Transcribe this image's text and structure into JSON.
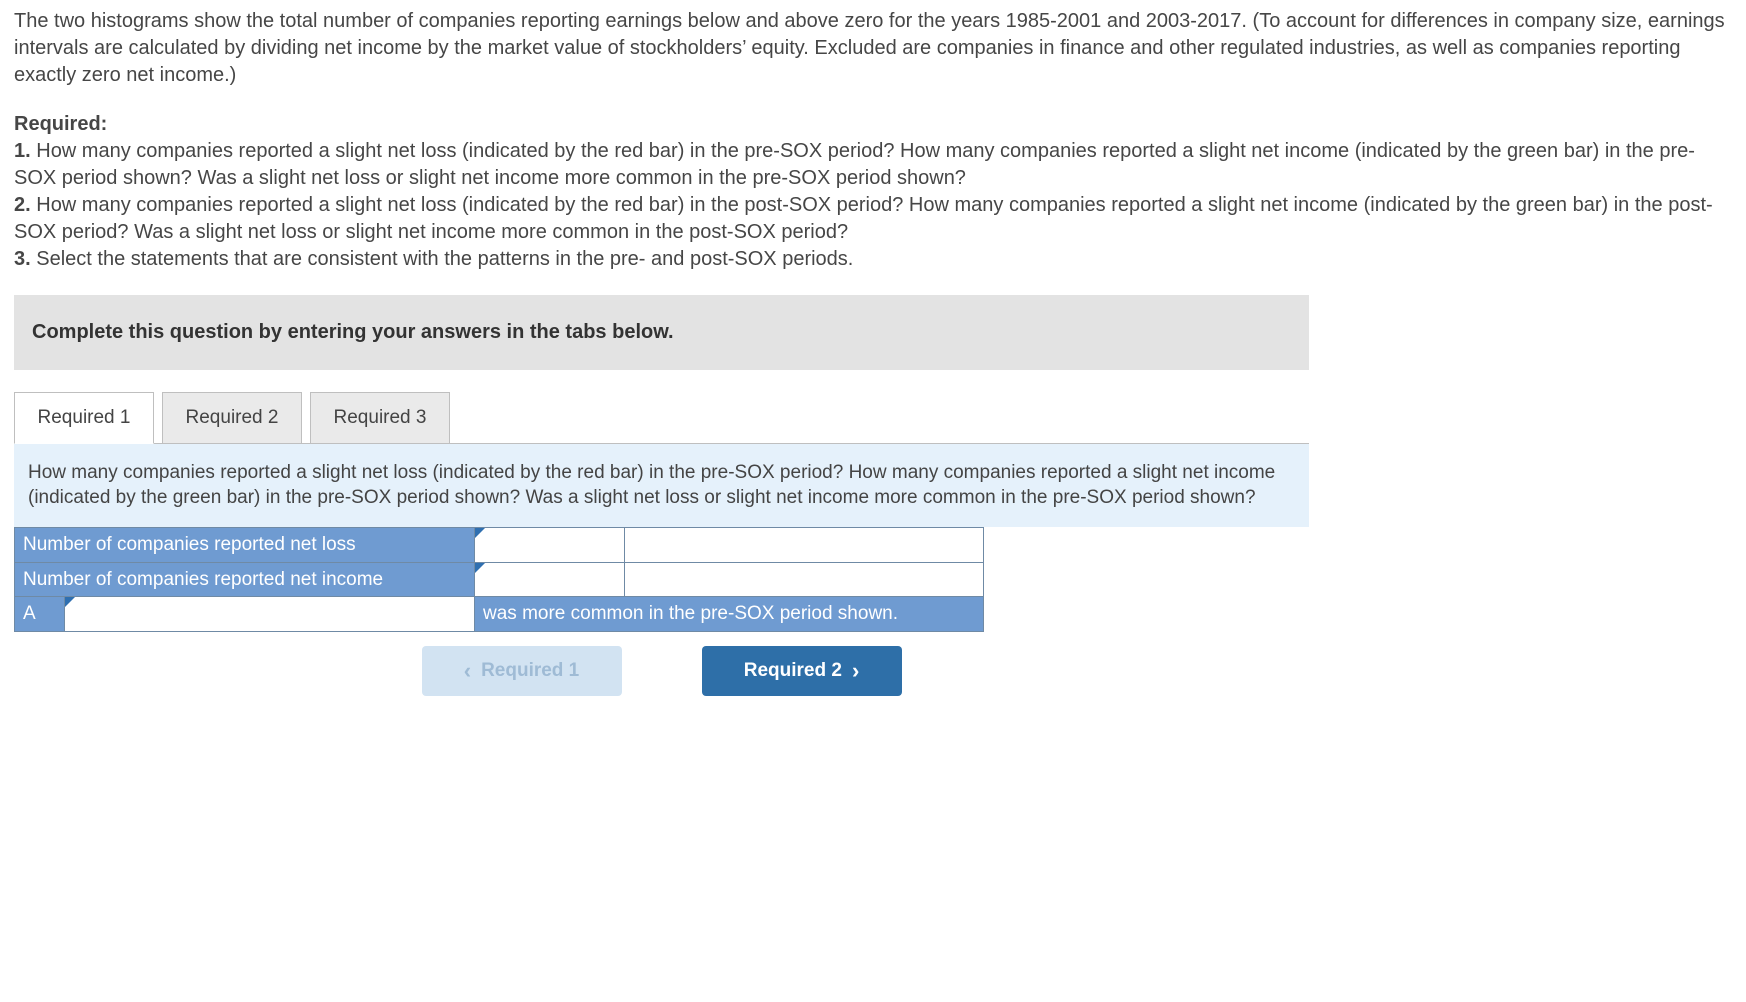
{
  "intro": "The two histograms show the total number of companies reporting earnings below and above zero for the years 1985-2001 and 2003-2017. (To account for differences in company size, earnings intervals are calculated by dividing net income by the market value of stockholders’ equity. Excluded are companies in finance and other regulated industries, as well as companies reporting exactly zero net income.)",
  "required": {
    "heading": "Required:",
    "q1num": "1.",
    "q1": " How many companies reported a slight net loss (indicated by the red bar) in the pre-SOX period? How many companies reported a slight net income (indicated by the green bar) in the pre-SOX period shown? Was a slight net loss or slight net income more common in the pre-SOX period shown?",
    "q2num": "2.",
    "q2": " How many companies reported a slight net loss (indicated by the red bar) in the post-SOX period? How many companies reported a slight net income (indicated by the green bar) in the post-SOX period? Was a slight net loss or slight net income more common in the post-SOX period?",
    "q3num": "3.",
    "q3": " Select the statements that are consistent with the patterns in the pre- and post-SOX periods."
  },
  "instruction": "Complete this question by entering your answers in the tabs below.",
  "tabs": {
    "t1": "Required 1",
    "t2": "Required 2",
    "t3": "Required 3"
  },
  "panel": {
    "prompt": "How many companies reported a slight net loss (indicated by the red bar) in the pre-SOX period? How many companies reported a slight net income (indicated by the green bar) in the pre-SOX period shown? Was a slight net loss or slight net income more common in the pre-SOX period shown?"
  },
  "table": {
    "row1_label": "Number of companies reported net loss",
    "row1_value": "",
    "row2_label": "Number of companies reported net income",
    "row2_value": "",
    "row3_a": "A",
    "row3_dd": "",
    "row3_tail": "was more common in the pre-SOX period shown."
  },
  "nav": {
    "prev": "Required 1",
    "next": "Required 2"
  }
}
